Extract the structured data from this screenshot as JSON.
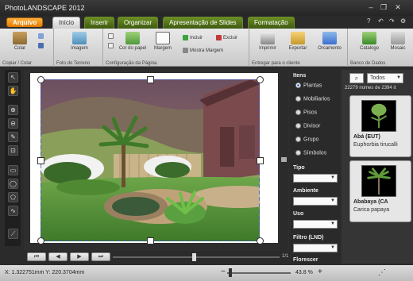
{
  "app": {
    "title": "PhotoLANDSCAPE 2012"
  },
  "tabs": {
    "file": "Arquivo",
    "items": [
      "Início",
      "Inserir",
      "Organizar",
      "Apresentação de Slides",
      "Formatação"
    ]
  },
  "ribbon": {
    "groups": {
      "clipboard": "Copiar / Colar",
      "terrain": "Foto do Terreno",
      "page_config": "Configuração da Página",
      "deliver": "Entregar para o cliente",
      "database": "Banco de Dados"
    },
    "buttons": {
      "paste": "Colar",
      "image": "Imagem",
      "paper_color": "Cor do papel",
      "margin": "Margem",
      "include": "Incluir",
      "exclude": "Excluir",
      "show_margin": "Mostra Margem",
      "print": "Imprimir",
      "export": "Exportar",
      "quote": "Orcamento",
      "catalog": "Catalogo",
      "mosaic": "Mosaic"
    }
  },
  "filter": {
    "items_head": "Itens",
    "items": [
      "Plantas",
      "Mobiliarios",
      "Pisos",
      "Divisor",
      "Grupo",
      "Símbolos"
    ],
    "selected_item": "Plantas",
    "type_head": "Tipo",
    "env_head": "Ambiente",
    "use_head": "Uso",
    "lnd_head": "Filtro (LND)",
    "flowering_head": "Florescer"
  },
  "catalog": {
    "select_value": "Todos",
    "count_text": "22279 nomes de 2394 it",
    "cards": [
      {
        "name": "Abá (EUT)",
        "scientific": "Euphorbia tirucalli"
      },
      {
        "name": "Ababaya (CA",
        "scientific": "Carica papaya"
      }
    ]
  },
  "nav": {
    "page_indicator": "1/1"
  },
  "status": {
    "coords": "X: 1.322751mm Y: 220.3704mm",
    "zoom": "43.8 %"
  },
  "colors": {
    "tab_green": "#6b8e23",
    "file_orange": "#f08c00",
    "accent_blue": "#3b6fd0"
  }
}
